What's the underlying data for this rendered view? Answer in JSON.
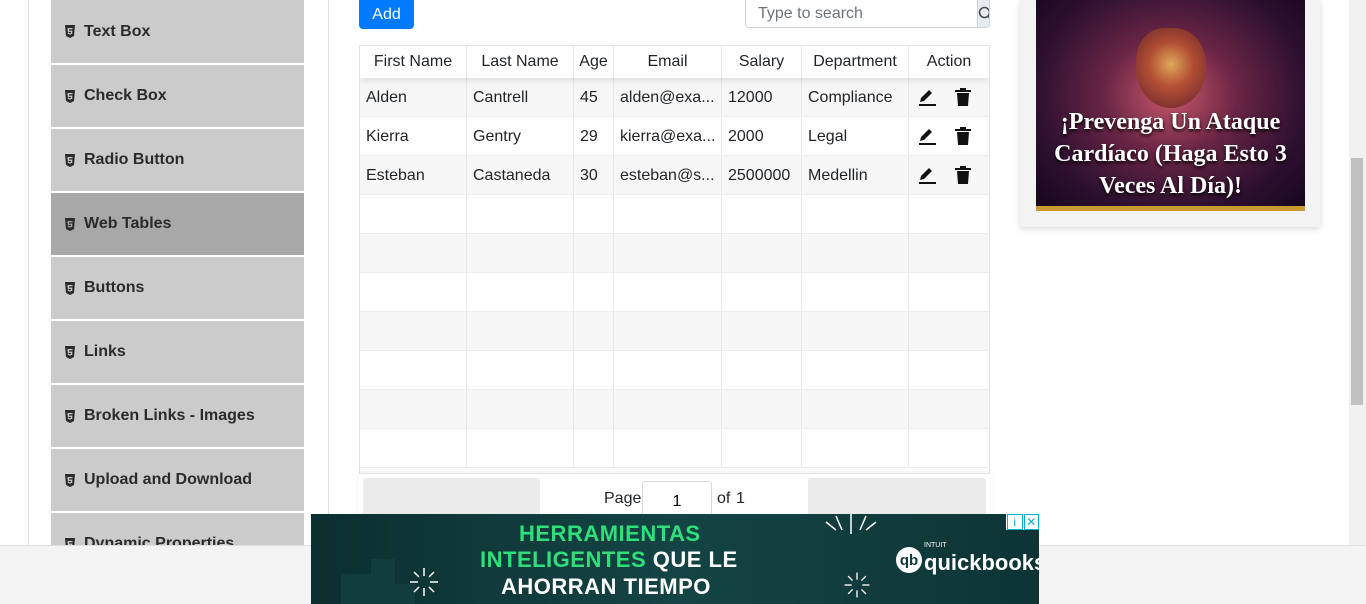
{
  "sidebar": {
    "items": [
      {
        "label": "Text Box",
        "active": false
      },
      {
        "label": "Check Box",
        "active": false
      },
      {
        "label": "Radio Button",
        "active": false
      },
      {
        "label": "Web Tables",
        "active": true
      },
      {
        "label": "Buttons",
        "active": false
      },
      {
        "label": "Links",
        "active": false
      },
      {
        "label": "Broken Links - Images",
        "active": false
      },
      {
        "label": "Upload and Download",
        "active": false
      },
      {
        "label": "Dynamic Properties",
        "active": false
      }
    ]
  },
  "toolbar": {
    "add_label": "Add",
    "search_placeholder": "Type to search"
  },
  "table": {
    "headers": [
      "First Name",
      "Last Name",
      "Age",
      "Email",
      "Salary",
      "Department",
      "Action"
    ],
    "rows": [
      {
        "first": "Alden",
        "last": "Cantrell",
        "age": "45",
        "email": "alden@exa...",
        "salary": "12000",
        "department": "Compliance"
      },
      {
        "first": "Kierra",
        "last": "Gentry",
        "age": "29",
        "email": "kierra@exa...",
        "salary": "2000",
        "department": "Legal"
      },
      {
        "first": "Esteban",
        "last": "Castaneda",
        "age": "30",
        "email": "esteban@s...",
        "salary": "2500000",
        "department": "Medellin"
      }
    ]
  },
  "pagination": {
    "page_label": "Page",
    "current_page": "1",
    "of_label": "of",
    "total_pages": "1"
  },
  "right_ad": {
    "text": "¡Prevenga Un Ataque Cardíaco (Haga Esto 3 Veces Al Día)!"
  },
  "bottom_ad": {
    "line1": "HERRAMIENTAS",
    "line2_green": "INTELIGENTES",
    "line2_white": " QUE LE",
    "line3": "AHORRAN TIEMPO",
    "brand_small": "INTUIT",
    "brand": "quickbooks",
    "brand_icon": "qb"
  },
  "colors": {
    "primary": "#007bff",
    "menu_bg": "#cbcbcb",
    "menu_active": "#a8a8a8",
    "ad_green": "#2ee07a"
  }
}
